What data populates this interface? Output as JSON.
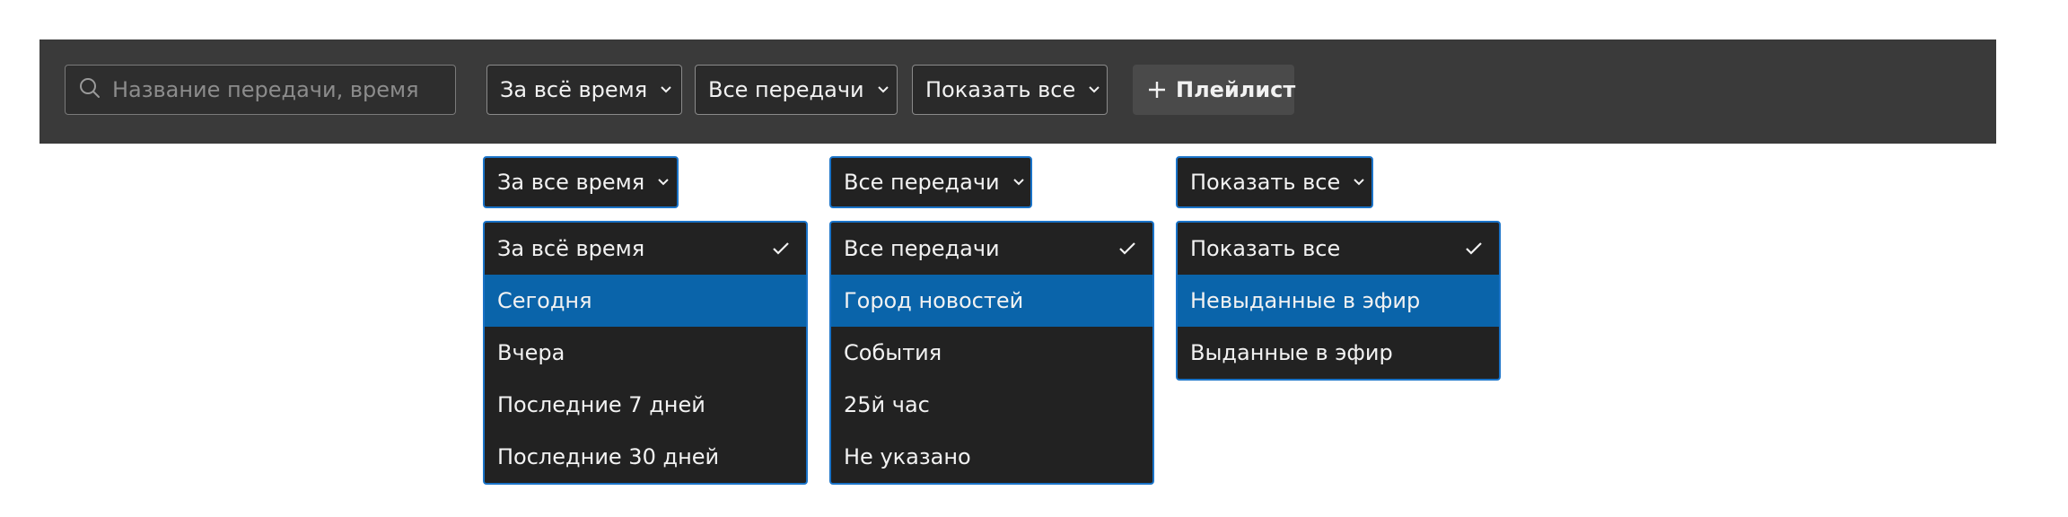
{
  "toolbar": {
    "search": {
      "placeholder": "Название передачи, время",
      "value": ""
    },
    "filters": [
      {
        "label": "За всё время",
        "icon": "chevron-down-icon"
      },
      {
        "label": "Все передачи",
        "icon": "chevron-down-icon"
      },
      {
        "label": "Показать все",
        "icon": "chevron-down-icon"
      }
    ],
    "playlist_label": "Плейлист"
  },
  "dropdowns": [
    {
      "trigger_label": "За все время",
      "options": [
        {
          "label": "За всё время",
          "selected": true
        },
        {
          "label": "Сегодня",
          "highlighted": true
        },
        {
          "label": "Вчера"
        },
        {
          "label": "Последние 7 дней"
        },
        {
          "label": "Последние 30 дней"
        }
      ]
    },
    {
      "trigger_label": "Все передачи",
      "options": [
        {
          "label": "Все передачи",
          "selected": true
        },
        {
          "label": "Город новостей",
          "highlighted": true
        },
        {
          "label": "События"
        },
        {
          "label": "25й час"
        },
        {
          "label": "Не указано"
        }
      ]
    },
    {
      "trigger_label": "Показать все",
      "options": [
        {
          "label": "Показать все",
          "selected": true
        },
        {
          "label": "Невыданные в эфир",
          "highlighted": true
        },
        {
          "label": "Выданные в эфир"
        }
      ]
    }
  ],
  "colors": {
    "toolbar_bg": "#3a3a3a",
    "menu_bg": "#222222",
    "accent_border": "#1a73c8",
    "highlight_bg": "#0a64aa"
  }
}
